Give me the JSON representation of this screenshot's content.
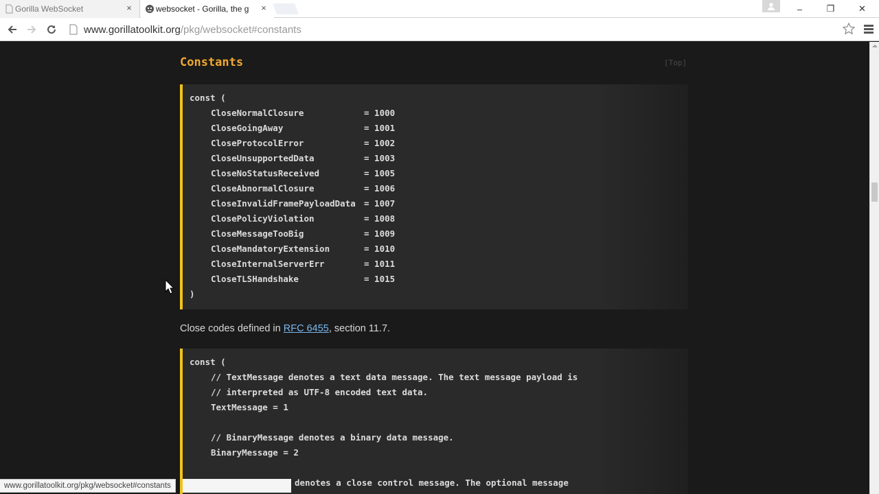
{
  "browser": {
    "tabs": [
      {
        "title": "Gorilla WebSocket",
        "close": "×"
      },
      {
        "title": "websocket - Gorilla, the g",
        "close": "×"
      }
    ],
    "window_controls": {
      "minimize": "–",
      "maximize": "❐",
      "close": "✕"
    },
    "url_host": "www.gorillatoolkit.org",
    "url_path": "/pkg/websocket#constants",
    "status_url": "www.gorillatoolkit.org/pkg/websocket#constants"
  },
  "page": {
    "section_title": "Constants",
    "top_link": "[Top]",
    "close_codes": {
      "open": "const (",
      "close": ")",
      "items": [
        {
          "name": "CloseNormalClosure",
          "value": "= 1000"
        },
        {
          "name": "CloseGoingAway",
          "value": "= 1001"
        },
        {
          "name": "CloseProtocolError",
          "value": "= 1002"
        },
        {
          "name": "CloseUnsupportedData",
          "value": "= 1003"
        },
        {
          "name": "CloseNoStatusReceived",
          "value": "= 1005"
        },
        {
          "name": "CloseAbnormalClosure",
          "value": "= 1006"
        },
        {
          "name": "CloseInvalidFramePayloadData",
          "value": "= 1007"
        },
        {
          "name": "ClosePolicyViolation",
          "value": "= 1008"
        },
        {
          "name": "CloseMessageTooBig",
          "value": "= 1009"
        },
        {
          "name": "CloseMandatoryExtension",
          "value": "= 1010"
        },
        {
          "name": "CloseInternalServerErr",
          "value": "= 1011"
        },
        {
          "name": "CloseTLSHandshake",
          "value": "= 1015"
        }
      ]
    },
    "description": {
      "before": "Close codes defined in ",
      "link": "RFC 6455",
      "after": ", section 11.7."
    },
    "message_types": {
      "open": "const (",
      "comment1": "// TextMessage denotes a text data message. The text message payload is",
      "comment2": "// interpreted as UTF-8 encoded text data.",
      "text_message": "TextMessage = 1",
      "comment3": "// BinaryMessage denotes a binary data message.",
      "binary_message": "BinaryMessage = 2",
      "comment4_partial": "denotes a close control message. The optional message"
    }
  },
  "colors": {
    "accent": "#f0a830",
    "code_border": "#f0c419",
    "link": "#7ab8f0",
    "background": "#1a1a1a"
  }
}
